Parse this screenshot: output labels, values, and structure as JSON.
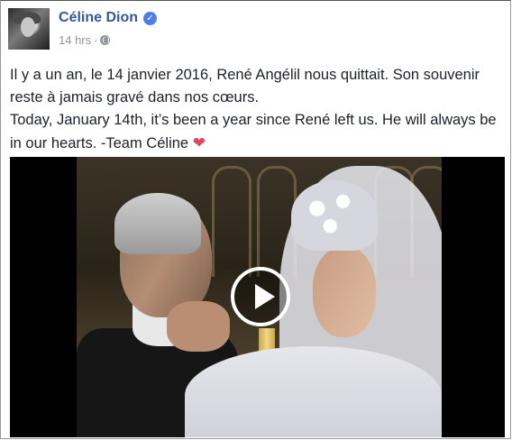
{
  "post": {
    "author": "Céline Dion",
    "verified_badge": "✓",
    "timestamp": "14 hrs",
    "separator": "·",
    "privacy_icon": "globe-icon",
    "text_fr": "Il y a un an, le 14 janvier 2016, René Angélil nous quittait. Son souvenir reste à jamais gravé dans nos cœurs.",
    "text_en": "Today, January 14th, it’s been a year since René left us. He will always be in our hearts. -Team Céline",
    "heart": "❤",
    "video": {
      "play_icon": "play-icon"
    }
  },
  "colors": {
    "author_link": "#365899",
    "meta": "#90949c",
    "text": "#1d2129",
    "heart": "#e04562",
    "verified": "#4c7ee8"
  }
}
